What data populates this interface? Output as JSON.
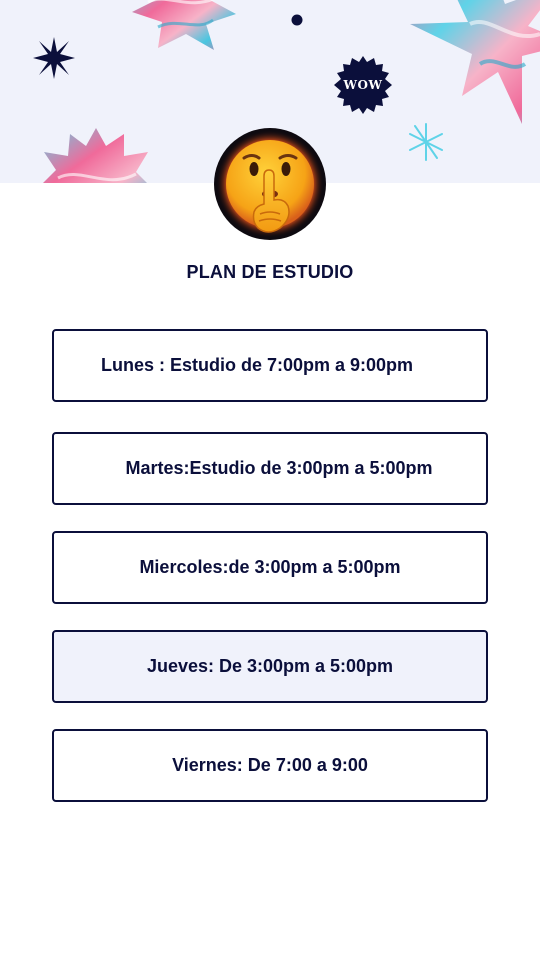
{
  "header": {
    "badge_text": "WOW",
    "avatar_icon": "shushing-face-emoji"
  },
  "title": "PLAN DE ESTUDIO",
  "schedule": {
    "items": [
      {
        "label": "Lunes : Estudio de 7:00pm a 9:00pm"
      },
      {
        "label": "Martes:Estudio de 3:00pm a 5:00pm"
      },
      {
        "label": "Miercoles:de 3:00pm a 5:00pm"
      },
      {
        "label": "Jueves: De 3:00pm a 5:00pm"
      },
      {
        "label": "Viernes: De 7:00 a 9:00"
      }
    ]
  },
  "colors": {
    "text": "#0b0f3b",
    "banner_background": "#f0f2fb",
    "highlight_background": "#f0f2fb",
    "card_border": "#0b0f3b",
    "accent_pink": "#f06a9a",
    "accent_cyan": "#5fd3e8"
  }
}
